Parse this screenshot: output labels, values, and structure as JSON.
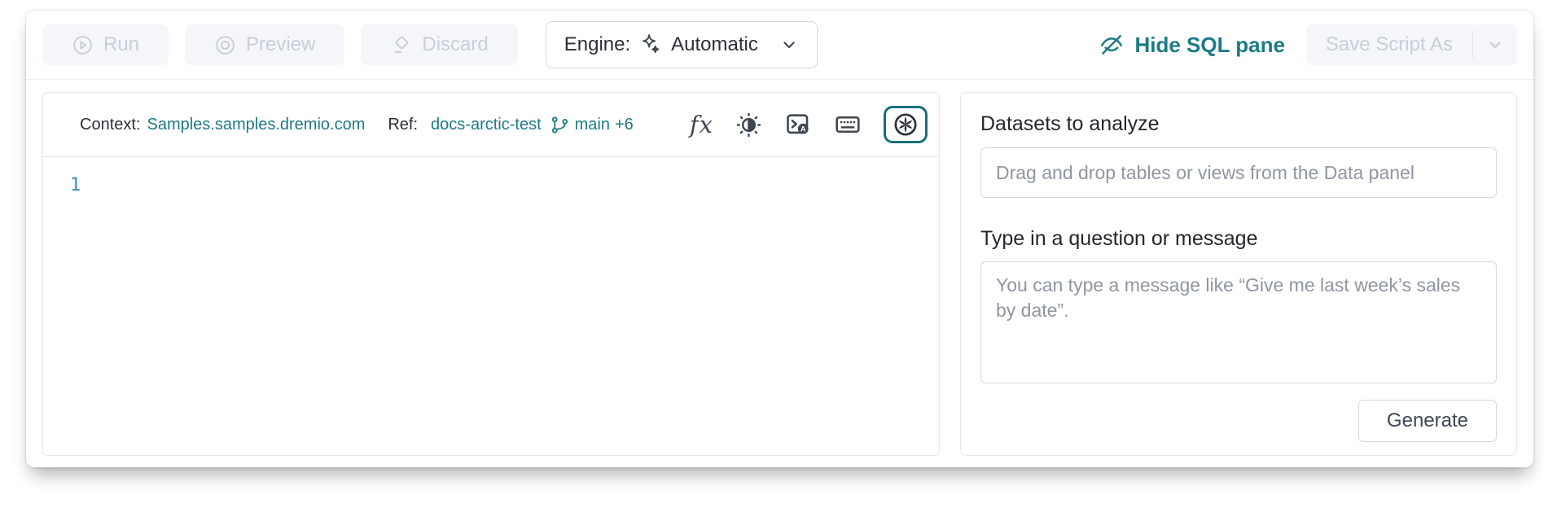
{
  "toolbar": {
    "run_label": "Run",
    "preview_label": "Preview",
    "discard_label": "Discard",
    "engine_label": "Engine:",
    "engine_value": "Automatic",
    "hide_sql_label": "Hide SQL pane",
    "save_script_label": "Save Script As"
  },
  "sql_pane": {
    "context_label": "Context:",
    "context_value": "Samples.samples.dremio.com",
    "ref_label": "Ref:",
    "ref_value": "docs-arctic-test",
    "branch_name": "main",
    "branch_extra": "+6",
    "line_number": "1"
  },
  "ai_panel": {
    "datasets_heading": "Datasets to analyze",
    "datasets_placeholder": "Drag and drop tables or views from the Data panel",
    "question_heading": "Type in a question or message",
    "question_placeholder": "You can type a message like “Give me last week’s sales by date”.",
    "generate_label": "Generate"
  },
  "icons": {
    "run": "play-circle",
    "preview": "target-circle",
    "discard": "eraser",
    "engine": "sparkle",
    "engine_caret": "chevron-down",
    "hide_sql": "eye-slash",
    "save_caret": "chevron-down",
    "branch": "git-branch",
    "function_glyph": "fx",
    "contrast": "brightness-contrast",
    "terminal": "terminal-autocomplete",
    "keyboard": "keyboard",
    "ai": "ai-rosette"
  },
  "colors": {
    "accent_teal": "#1d7b84",
    "active_ring_teal": "#18707b",
    "line_number_blue": "#3a8cba",
    "disabled_text": "#c8cfd9",
    "disabled_bg": "#f4f6f9",
    "border": "#e5e8ec",
    "input_border": "#d4d9e0",
    "placeholder": "#8f96a1"
  }
}
